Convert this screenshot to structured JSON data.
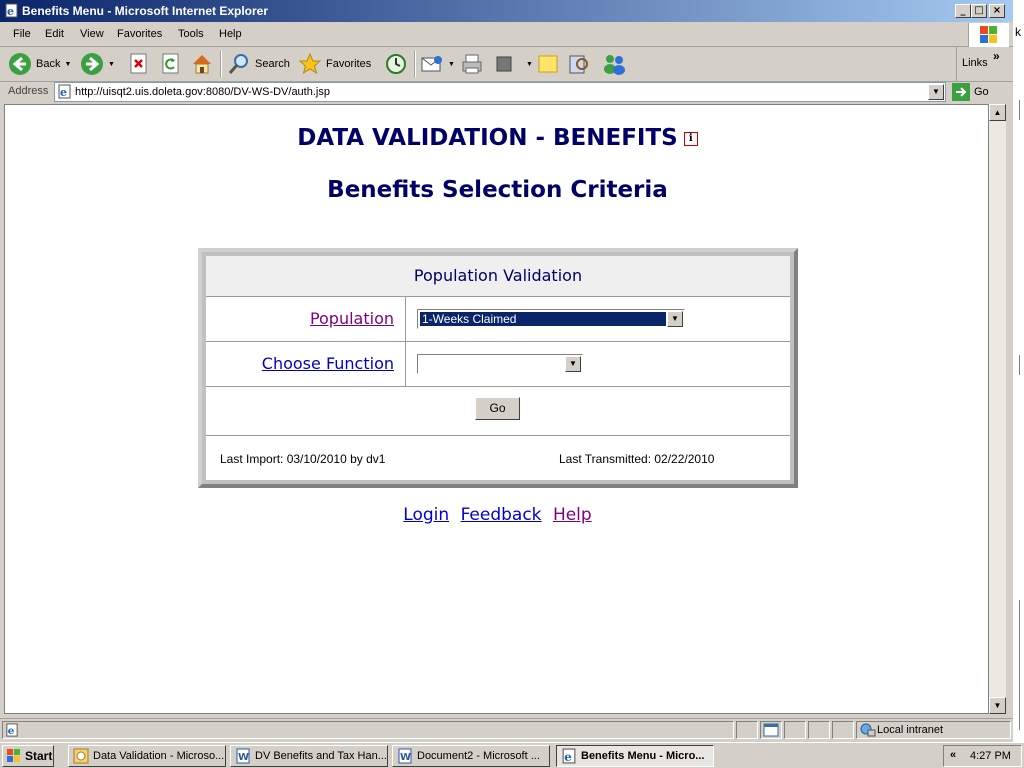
{
  "window": {
    "title": "Benefits Menu - Microsoft Internet Explorer",
    "minimize": "_",
    "maximize": "□",
    "close": "×"
  },
  "menu": [
    "File",
    "Edit",
    "View",
    "Favorites",
    "Tools",
    "Help"
  ],
  "toolbar": {
    "back": "Back",
    "search": "Search",
    "favorites": "Favorites",
    "links": "Links",
    "links_chevron": "»"
  },
  "address": {
    "label": "Address",
    "url": "http://uisqt2.uis.doleta.gov:8080/DV-WS-DV/auth.jsp",
    "go": "Go"
  },
  "page": {
    "title": "DATA VALIDATION - BENEFITS",
    "info_icon": "i",
    "subtitle": "Benefits Selection Criteria",
    "panel": {
      "header": "Population Validation",
      "population_label": "Population",
      "population_value": "1-Weeks Claimed",
      "function_label": "Choose Function",
      "function_value": "",
      "go_button": "Go",
      "last_import": "Last Import: 03/10/2010 by dv1",
      "last_transmitted": "Last Transmitted: 02/22/2010"
    },
    "links": {
      "login": "Login",
      "feedback": "Feedback",
      "help": "Help"
    }
  },
  "status": {
    "zone": "Local intranet"
  },
  "taskbar": {
    "start": "Start",
    "tasks": [
      "Data Validation - Microso...",
      "DV Benefits and Tax Han...",
      "Document2 - Microsoft ...",
      "Benefits Menu - Micro..."
    ],
    "tray_chevron": "«",
    "clock": "4:27 PM"
  },
  "colors": {
    "heading": "#000066",
    "link": "#0000cc",
    "visited_link": "#800080",
    "title_bar": "#0a246a",
    "selection": "#0a246a"
  },
  "icons": [
    "ie-page-icon",
    "windows-logo-icon",
    "back-arrow-icon",
    "forward-arrow-icon",
    "stop-icon",
    "refresh-icon",
    "home-icon",
    "search-magnifier-icon",
    "favorites-star-icon",
    "history-icon",
    "mail-icon",
    "print-icon",
    "edit-icon",
    "discuss-icon",
    "research-icon",
    "messenger-icon",
    "go-arrow-icon",
    "info-icon",
    "local-intranet-icon"
  ]
}
